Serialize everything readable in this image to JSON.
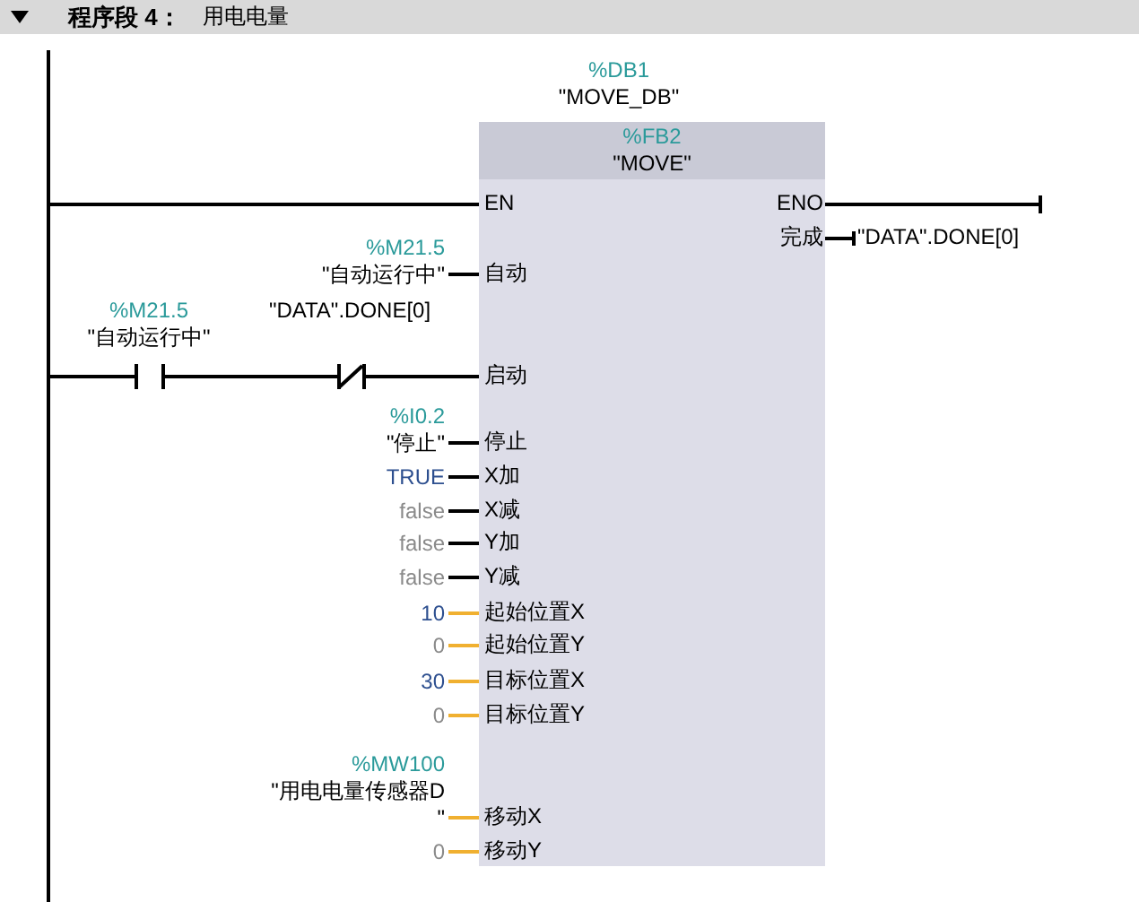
{
  "header": {
    "expanded": true,
    "title": "程序段 4：",
    "comment": "用电电量"
  },
  "instance": {
    "address": "%DB1",
    "name": "\"MOVE_DB\""
  },
  "block": {
    "address": "%FB2",
    "name": "\"MOVE\"",
    "en": "EN",
    "eno": "ENO"
  },
  "contacts": [
    {
      "kind": "no",
      "address": "%M21.5",
      "operand": "\"自动运行中\""
    },
    {
      "kind": "nc",
      "operand": "\"DATA\".DONE[0]"
    }
  ],
  "inputs": [
    {
      "pin": "自动",
      "kind": "bool",
      "constant": false,
      "greyed": false,
      "address": "%M21.5",
      "operand": "\"自动运行中\""
    },
    {
      "pin": "启动"
    },
    {
      "pin": "停止",
      "kind": "bool",
      "constant": false,
      "greyed": false,
      "address": "%I0.2",
      "operand": "\"停止\""
    },
    {
      "pin": "X加",
      "kind": "bool",
      "constant": true,
      "greyed": false,
      "operand": "TRUE"
    },
    {
      "pin": "X减",
      "kind": "bool",
      "greyed": true,
      "operand": "false"
    },
    {
      "pin": "Y加",
      "kind": "bool",
      "greyed": true,
      "operand": "false"
    },
    {
      "pin": "Y减",
      "kind": "bool",
      "greyed": true,
      "operand": "false"
    },
    {
      "pin": "起始位置X",
      "kind": "int",
      "constant": true,
      "greyed": false,
      "operand": "10"
    },
    {
      "pin": "起始位置Y",
      "kind": "int",
      "greyed": true,
      "operand": "0"
    },
    {
      "pin": "目标位置X",
      "kind": "int",
      "constant": true,
      "greyed": false,
      "operand": "30"
    },
    {
      "pin": "目标位置Y",
      "kind": "int",
      "greyed": true,
      "operand": "0"
    },
    {
      "pin": "移动X",
      "kind": "int",
      "constant": false,
      "greyed": false,
      "address": "%MW100",
      "operand": "\"用电电量传感器D\""
    },
    {
      "pin": "移动Y",
      "kind": "int",
      "greyed": true,
      "operand": "0"
    }
  ],
  "outputs": [
    {
      "pin": "完成",
      "operand": "\"DATA\".DONE[0]"
    }
  ]
}
